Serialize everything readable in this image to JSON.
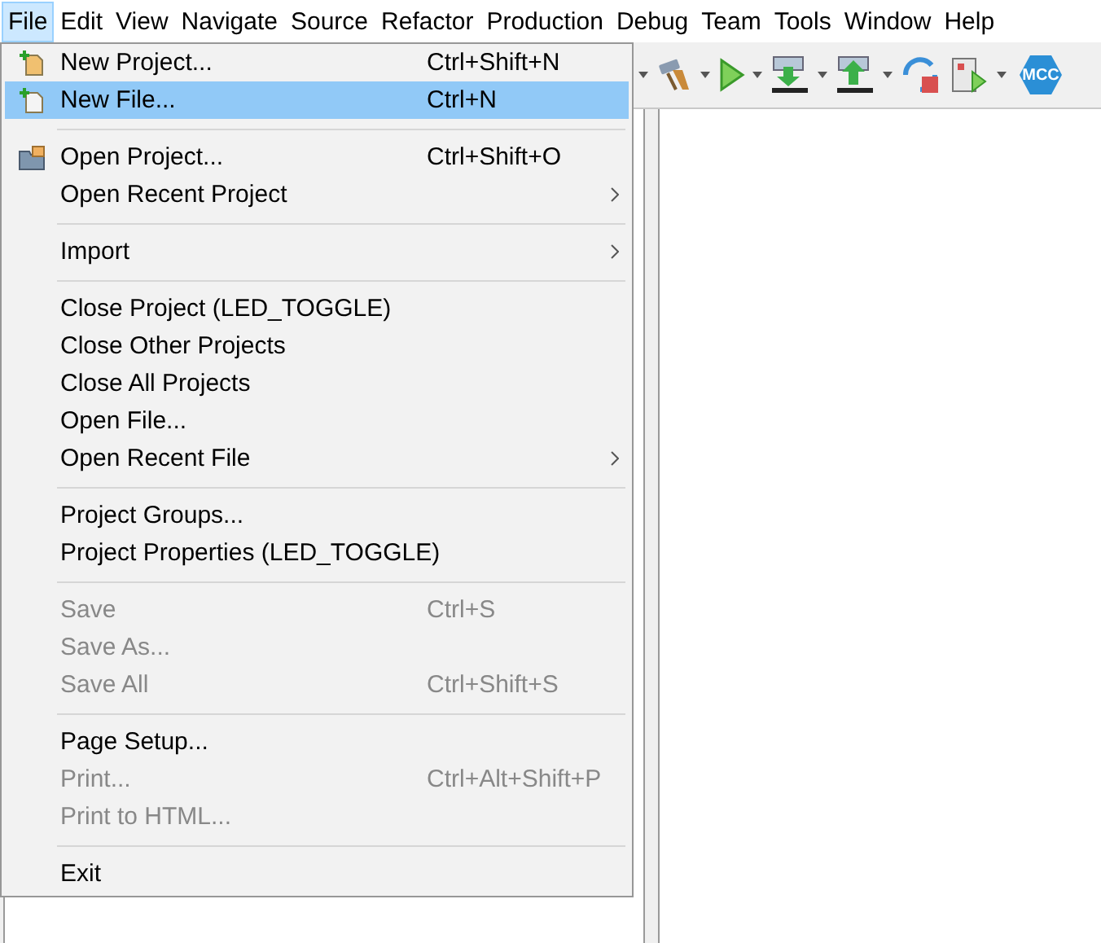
{
  "menu_bar": {
    "items": [
      {
        "label": "File",
        "selected": true
      },
      {
        "label": "Edit",
        "selected": false
      },
      {
        "label": "View",
        "selected": false
      },
      {
        "label": "Navigate",
        "selected": false
      },
      {
        "label": "Source",
        "selected": false
      },
      {
        "label": "Refactor",
        "selected": false
      },
      {
        "label": "Production",
        "selected": false
      },
      {
        "label": "Debug",
        "selected": false
      },
      {
        "label": "Team",
        "selected": false
      },
      {
        "label": "Tools",
        "selected": false
      },
      {
        "label": "Window",
        "selected": false
      },
      {
        "label": "Help",
        "selected": false
      }
    ]
  },
  "toolbar": {
    "mcc_label": "MCC"
  },
  "file_menu": {
    "groups": [
      {
        "items": [
          {
            "label": "New Project...",
            "shortcut": "Ctrl+Shift+N",
            "submenu": false,
            "disabled": false,
            "selected": false
          },
          {
            "label": "New File...",
            "shortcut": "Ctrl+N",
            "submenu": false,
            "disabled": false,
            "selected": true
          }
        ]
      },
      {
        "items": [
          {
            "label": "Open Project...",
            "shortcut": "Ctrl+Shift+O",
            "submenu": false,
            "disabled": false,
            "selected": false
          },
          {
            "label": "Open Recent Project",
            "submenu": true,
            "disabled": false,
            "selected": false
          }
        ]
      },
      {
        "items": [
          {
            "label": "Import",
            "submenu": true,
            "disabled": false,
            "selected": false
          }
        ]
      },
      {
        "items": [
          {
            "label": "Close Project (LED_TOGGLE)",
            "submenu": false,
            "disabled": false,
            "selected": false
          },
          {
            "label": "Close Other Projects",
            "submenu": false,
            "disabled": false,
            "selected": false
          },
          {
            "label": "Close All Projects",
            "submenu": false,
            "disabled": false,
            "selected": false
          },
          {
            "label": "Open File...",
            "submenu": false,
            "disabled": false,
            "selected": false
          },
          {
            "label": "Open Recent File",
            "submenu": true,
            "disabled": false,
            "selected": false
          }
        ]
      },
      {
        "items": [
          {
            "label": "Project Groups...",
            "submenu": false,
            "disabled": false,
            "selected": false
          },
          {
            "label": "Project Properties (LED_TOGGLE)",
            "submenu": false,
            "disabled": false,
            "selected": false
          }
        ]
      },
      {
        "items": [
          {
            "label": "Save",
            "shortcut": "Ctrl+S",
            "submenu": false,
            "disabled": true,
            "selected": false
          },
          {
            "label": "Save As...",
            "submenu": false,
            "disabled": true,
            "selected": false
          },
          {
            "label": "Save All",
            "shortcut": "Ctrl+Shift+S",
            "submenu": false,
            "disabled": true,
            "selected": false
          }
        ]
      },
      {
        "items": [
          {
            "label": "Page Setup...",
            "submenu": false,
            "disabled": false,
            "selected": false
          },
          {
            "label": "Print...",
            "shortcut": "Ctrl+Alt+Shift+P",
            "submenu": false,
            "disabled": true,
            "selected": false
          },
          {
            "label": "Print to HTML...",
            "submenu": false,
            "disabled": true,
            "selected": false
          }
        ]
      },
      {
        "items": [
          {
            "label": "Exit",
            "submenu": false,
            "disabled": false,
            "selected": false
          }
        ]
      }
    ]
  }
}
